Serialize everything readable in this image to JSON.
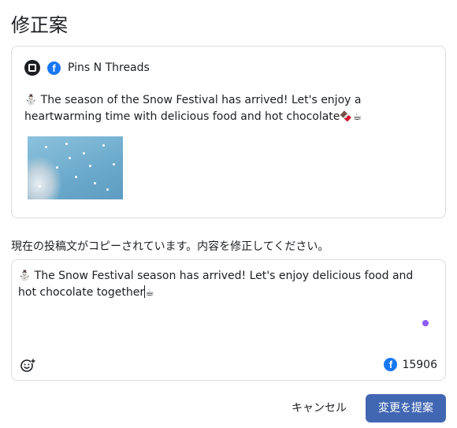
{
  "page": {
    "title": "修正案"
  },
  "original_post": {
    "account_name": "Pins N Threads",
    "account_avatar_icon": "spool-logo-icon",
    "platform_icon": "facebook-icon",
    "lead_emoji": "⛄",
    "text": "The season of the Snow Festival has arrived! Let's enjoy a heartwarming time with delicious food and hot chocolate",
    "trailing_emojis": "🍫☕"
  },
  "instruction": "現在の投稿文がコピーされています。内容を修正してください。",
  "editor": {
    "lead_emoji": "⛄",
    "text": "The Snow Festival season has arrived! Let's enjoy delicious food and hot chocolate together",
    "trailing_emoji": "☕",
    "count": "15906",
    "emoji_button_icon": "smiley-plus-icon",
    "platform_icon": "facebook-icon"
  },
  "actions": {
    "cancel_label": "キャンセル",
    "submit_label": "変更を提案"
  },
  "colors": {
    "primary_button": "#4267b2",
    "facebook_blue": "#1877f2",
    "status_dot": "#8b5cf6",
    "border": "#dadde1"
  }
}
